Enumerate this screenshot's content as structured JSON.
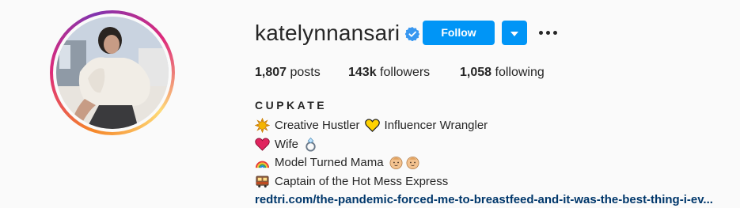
{
  "profile": {
    "username": "katelynnansari",
    "verified": true,
    "full_name": "CUPKATE",
    "avatar_icon": "profile-photo",
    "colors": {
      "follow_bg": "#0095f6",
      "link": "#00376b",
      "verified": "#3897f0",
      "ring": [
        "#f58529",
        "#dd2a7b",
        "#8134af",
        "#feda77"
      ]
    }
  },
  "actions": {
    "follow_label": "Follow",
    "dropdown_icon": "caret-down-icon",
    "more_icon": "ellipsis-icon"
  },
  "stats": [
    {
      "value": "1,807",
      "label": "posts"
    },
    {
      "value": "143k",
      "label": "followers"
    },
    {
      "value": "1,058",
      "label": "following"
    }
  ],
  "bio": {
    "lines": [
      {
        "text": "Creative Hustler",
        "text2": "Influencer Wrangler",
        "icons": [
          "sun-emoji",
          "yellow-heart-emoji"
        ]
      },
      {
        "text": "Wife",
        "icons": [
          "red-heart-emoji",
          "ring-emoji"
        ]
      },
      {
        "text": "Model Turned Mama",
        "icons": [
          "rainbow-emoji",
          "baby-emoji",
          "baby-emoji"
        ]
      },
      {
        "text": "Captain of the Hot Mess Express",
        "icons": [
          "train-emoji"
        ]
      }
    ],
    "link": "redtri.com/the-pandemic-forced-me-to-breastfeed-and-it-was-the-best-thing-i-ev..."
  }
}
